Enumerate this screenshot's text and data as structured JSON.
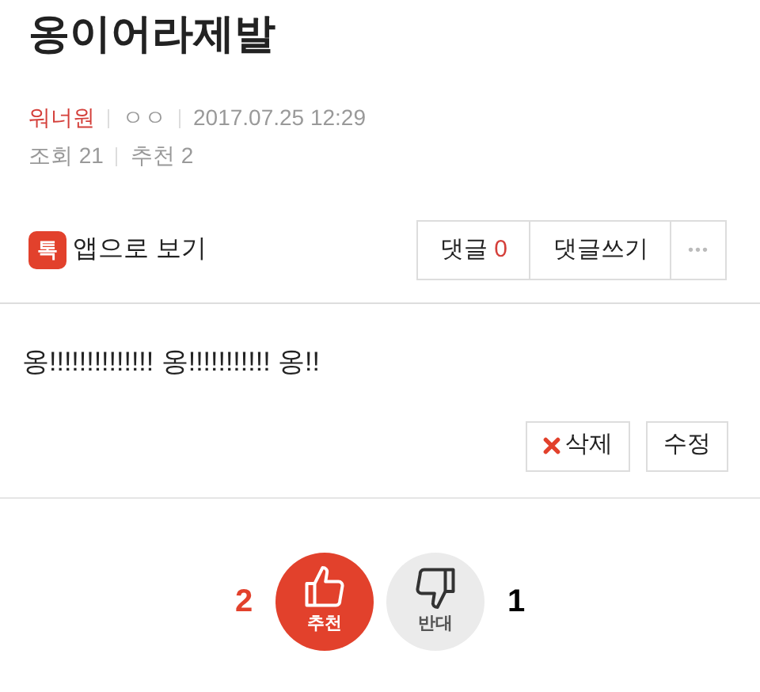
{
  "title": "옹이어라제발",
  "meta": {
    "author": "워너원",
    "nickname": "ㅇㅇ",
    "datetime": "2017.07.25 12:29",
    "views": "조회 21",
    "recommends": "추천 2"
  },
  "app_link": {
    "icon_label": "톡",
    "label": "앱으로 보기"
  },
  "actions": {
    "comments_label": "댓글",
    "comments_count": "0",
    "write_label": "댓글쓰기",
    "more_label": "•••"
  },
  "body": "옹!!!!!!!!!!!!!! 옹!!!!!!!!!!! 옹!!",
  "post_buttons": [
    {
      "kind": "delete",
      "label": "삭제"
    },
    {
      "kind": "edit",
      "label": "수정"
    }
  ],
  "votes": [
    {
      "kind": "up",
      "count": "2",
      "label": "추천",
      "selected": true
    },
    {
      "kind": "down",
      "count": "1",
      "label": "반대",
      "selected": false
    }
  ]
}
